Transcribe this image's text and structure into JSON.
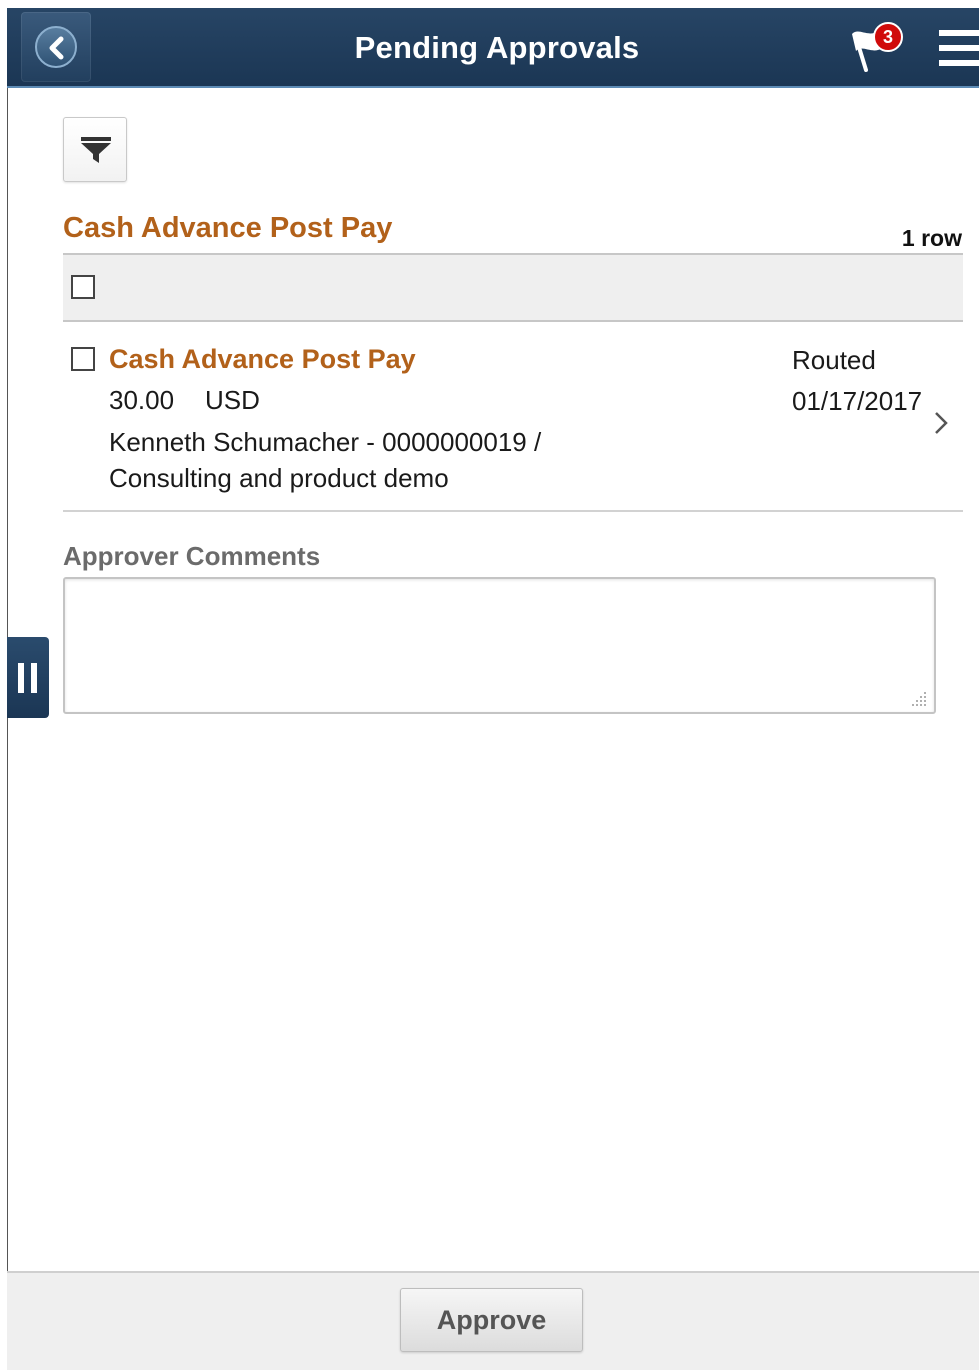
{
  "header": {
    "title": "Pending Approvals",
    "notification_count": "3",
    "colors": {
      "bar": "#1b3654",
      "badge": "#d00b0b"
    }
  },
  "toolbar": {
    "filter_icon": "filter-icon"
  },
  "section": {
    "title": "Cash Advance Post Pay",
    "row_count": "1 row",
    "title_color": "#b2611a"
  },
  "items": [
    {
      "title": "Cash Advance Post Pay",
      "amount": "30.00",
      "currency": "USD",
      "description_line1": "Kenneth Schumacher - 0000000019 /",
      "description_line2": "Consulting and product demo",
      "status": "Routed",
      "date": "01/17/2017",
      "checked": false
    }
  ],
  "comments": {
    "label": "Approver Comments",
    "value": ""
  },
  "footer": {
    "approve_label": "Approve"
  }
}
